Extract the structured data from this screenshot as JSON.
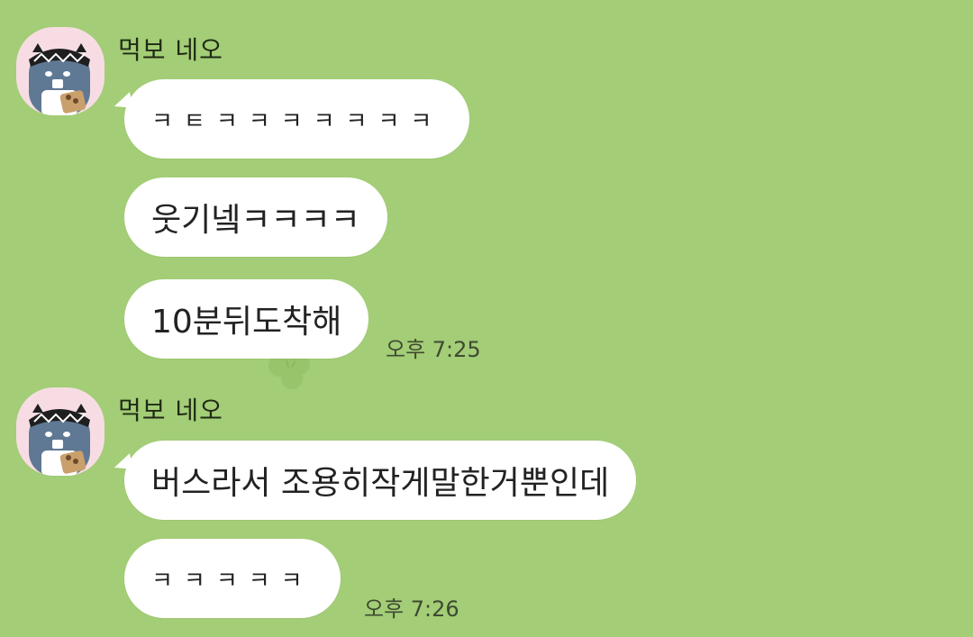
{
  "groups": [
    {
      "sender": "먹보 네오",
      "messages": [
        {
          "text": "ㅋㅌㅋㅋㅋㅋㅋㅋㅋ"
        },
        {
          "text": "웃기넼ㅋㅋㅋㅋ"
        },
        {
          "text": "10분뒤도착해"
        }
      ],
      "time": "오후 7:25"
    },
    {
      "sender": "먹보 네오",
      "messages": [
        {
          "text": "버스라서 조용히작게말한거뿐인데"
        },
        {
          "text": "ㅋㅋㅋㅋㅋ"
        }
      ],
      "time": "오후 7:26"
    }
  ],
  "colors": {
    "background": "#a3cd76",
    "bubble": "#ffffff",
    "avatar_bg": "#f7dde3"
  }
}
